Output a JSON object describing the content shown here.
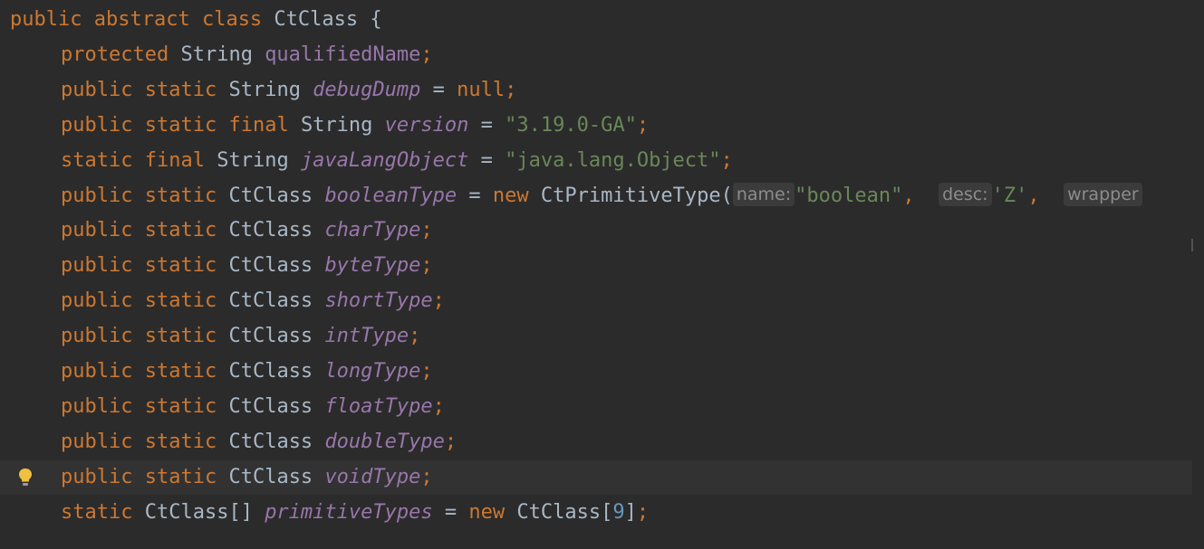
{
  "editor": {
    "lines": [
      {
        "tokens": [
          {
            "t": "public",
            "c": "kw"
          },
          {
            "t": " ",
            "c": "ty"
          },
          {
            "t": "abstract",
            "c": "kw"
          },
          {
            "t": " ",
            "c": "ty"
          },
          {
            "t": "class",
            "c": "kw"
          },
          {
            "t": " CtClass {",
            "c": "ty"
          }
        ],
        "indent": 0
      },
      {
        "tokens": [
          {
            "t": "protected",
            "c": "kw"
          },
          {
            "t": " String ",
            "c": "ty"
          },
          {
            "t": "qualifiedName",
            "c": "fld"
          },
          {
            "t": ";",
            "c": "kw"
          }
        ],
        "indent": 1
      },
      {
        "tokens": [
          {
            "t": "public",
            "c": "kw"
          },
          {
            "t": " ",
            "c": "ty"
          },
          {
            "t": "static",
            "c": "kw"
          },
          {
            "t": " String ",
            "c": "ty"
          },
          {
            "t": "debugDump",
            "c": "sfld"
          },
          {
            "t": " = ",
            "c": "ty"
          },
          {
            "t": "null",
            "c": "kw"
          },
          {
            "t": ";",
            "c": "kw"
          }
        ],
        "indent": 1
      },
      {
        "tokens": [
          {
            "t": "public",
            "c": "kw"
          },
          {
            "t": " ",
            "c": "ty"
          },
          {
            "t": "static",
            "c": "kw"
          },
          {
            "t": " ",
            "c": "ty"
          },
          {
            "t": "final",
            "c": "kw"
          },
          {
            "t": " String ",
            "c": "ty"
          },
          {
            "t": "version",
            "c": "sfld"
          },
          {
            "t": " = ",
            "c": "ty"
          },
          {
            "t": "\"3.19.0-GA\"",
            "c": "str"
          },
          {
            "t": ";",
            "c": "kw"
          }
        ],
        "indent": 1
      },
      {
        "tokens": [
          {
            "t": "static",
            "c": "kw"
          },
          {
            "t": " ",
            "c": "ty"
          },
          {
            "t": "final",
            "c": "kw"
          },
          {
            "t": " String ",
            "c": "ty"
          },
          {
            "t": "javaLangObject",
            "c": "sfld"
          },
          {
            "t": " = ",
            "c": "ty"
          },
          {
            "t": "\"java.lang.Object\"",
            "c": "str"
          },
          {
            "t": ";",
            "c": "kw"
          }
        ],
        "indent": 1
      },
      {
        "tokens": [
          {
            "t": "public",
            "c": "kw"
          },
          {
            "t": " ",
            "c": "ty"
          },
          {
            "t": "static",
            "c": "kw"
          },
          {
            "t": " CtClass ",
            "c": "ty"
          },
          {
            "t": "booleanType",
            "c": "sfld"
          },
          {
            "t": " = ",
            "c": "ty"
          },
          {
            "t": "new",
            "c": "kw"
          },
          {
            "t": " CtPrimitiveType(",
            "c": "ty"
          },
          {
            "t": "name:",
            "c": "hint"
          },
          {
            "t": "\"boolean\"",
            "c": "str"
          },
          {
            "t": ",  ",
            "c": "kw"
          },
          {
            "t": "desc:",
            "c": "hint"
          },
          {
            "t": "'Z'",
            "c": "str"
          },
          {
            "t": ",  ",
            "c": "kw"
          },
          {
            "t": "wrapper",
            "c": "hint"
          }
        ],
        "indent": 1
      },
      {
        "tokens": [
          {
            "t": "public",
            "c": "kw"
          },
          {
            "t": " ",
            "c": "ty"
          },
          {
            "t": "static",
            "c": "kw"
          },
          {
            "t": " CtClass ",
            "c": "ty"
          },
          {
            "t": "charType",
            "c": "sfld"
          },
          {
            "t": ";",
            "c": "kw"
          }
        ],
        "indent": 1
      },
      {
        "tokens": [
          {
            "t": "public",
            "c": "kw"
          },
          {
            "t": " ",
            "c": "ty"
          },
          {
            "t": "static",
            "c": "kw"
          },
          {
            "t": " CtClass ",
            "c": "ty"
          },
          {
            "t": "byteType",
            "c": "sfld"
          },
          {
            "t": ";",
            "c": "kw"
          }
        ],
        "indent": 1
      },
      {
        "tokens": [
          {
            "t": "public",
            "c": "kw"
          },
          {
            "t": " ",
            "c": "ty"
          },
          {
            "t": "static",
            "c": "kw"
          },
          {
            "t": " CtClass ",
            "c": "ty"
          },
          {
            "t": "shortType",
            "c": "sfld"
          },
          {
            "t": ";",
            "c": "kw"
          }
        ],
        "indent": 1
      },
      {
        "tokens": [
          {
            "t": "public",
            "c": "kw"
          },
          {
            "t": " ",
            "c": "ty"
          },
          {
            "t": "static",
            "c": "kw"
          },
          {
            "t": " CtClass ",
            "c": "ty"
          },
          {
            "t": "intType",
            "c": "sfld"
          },
          {
            "t": ";",
            "c": "kw"
          }
        ],
        "indent": 1
      },
      {
        "tokens": [
          {
            "t": "public",
            "c": "kw"
          },
          {
            "t": " ",
            "c": "ty"
          },
          {
            "t": "static",
            "c": "kw"
          },
          {
            "t": " CtClass ",
            "c": "ty"
          },
          {
            "t": "longType",
            "c": "sfld"
          },
          {
            "t": ";",
            "c": "kw"
          }
        ],
        "indent": 1
      },
      {
        "tokens": [
          {
            "t": "public",
            "c": "kw"
          },
          {
            "t": " ",
            "c": "ty"
          },
          {
            "t": "static",
            "c": "kw"
          },
          {
            "t": " CtClass ",
            "c": "ty"
          },
          {
            "t": "floatType",
            "c": "sfld"
          },
          {
            "t": ";",
            "c": "kw"
          }
        ],
        "indent": 1
      },
      {
        "tokens": [
          {
            "t": "public",
            "c": "kw"
          },
          {
            "t": " ",
            "c": "ty"
          },
          {
            "t": "static",
            "c": "kw"
          },
          {
            "t": " CtClass ",
            "c": "ty"
          },
          {
            "t": "doubleType",
            "c": "sfld"
          },
          {
            "t": ";",
            "c": "kw"
          }
        ],
        "indent": 1
      },
      {
        "tokens": [
          {
            "t": "public",
            "c": "kw"
          },
          {
            "t": " ",
            "c": "ty"
          },
          {
            "t": "static",
            "c": "kw"
          },
          {
            "t": " CtClass ",
            "c": "ty"
          },
          {
            "t": "voidType",
            "c": "sfld"
          },
          {
            "t": ";",
            "c": "kw"
          }
        ],
        "indent": 1,
        "current": true,
        "bulb": true
      },
      {
        "tokens": [
          {
            "t": "static",
            "c": "kw"
          },
          {
            "t": " CtClass[] ",
            "c": "ty"
          },
          {
            "t": "primitiveTypes",
            "c": "sfld"
          },
          {
            "t": " = ",
            "c": "ty"
          },
          {
            "t": "new",
            "c": "kw"
          },
          {
            "t": " CtClass[",
            "c": "ty"
          },
          {
            "t": "9",
            "c": "num"
          },
          {
            "t": "]",
            "c": "ty"
          },
          {
            "t": ";",
            "c": "kw"
          }
        ],
        "indent": 1
      }
    ],
    "colors": {
      "background": "#2b2b2b",
      "keyword": "#cc7832",
      "text": "#a9b7c6",
      "field": "#9876aa",
      "string": "#6a8759",
      "number": "#6897bb",
      "current_line": "#323232",
      "bulb": "#f0c040"
    },
    "icons": {
      "intention": "lightbulb-icon"
    }
  }
}
